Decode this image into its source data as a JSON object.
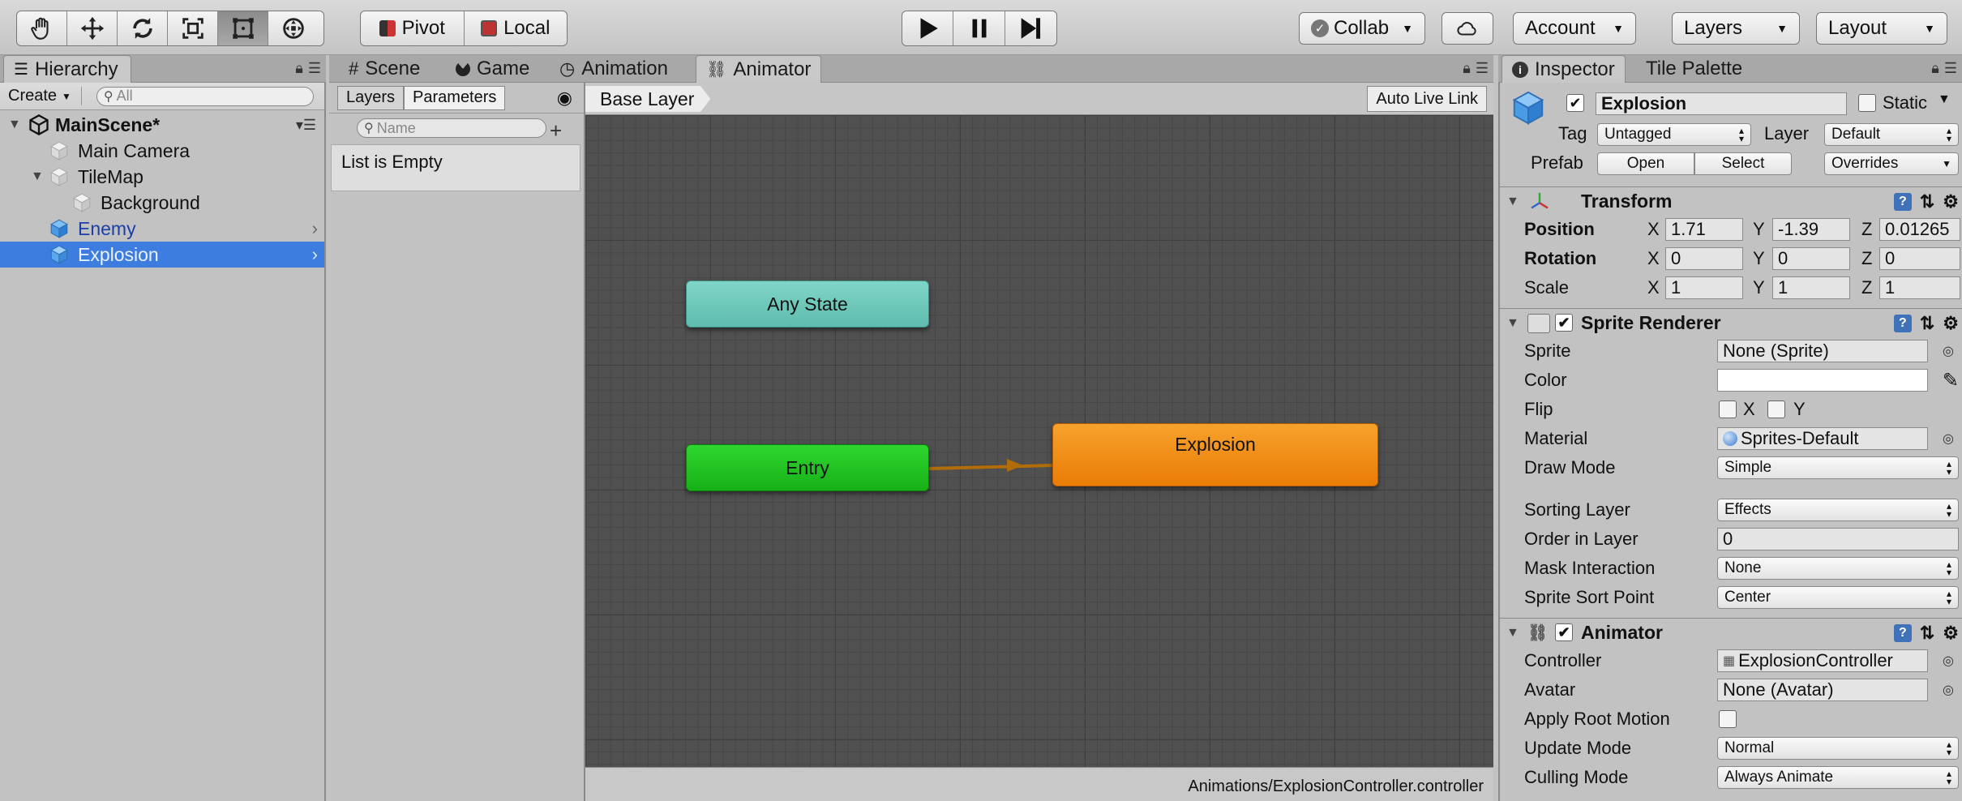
{
  "toolbar": {
    "pivot_label": "Pivot",
    "local_label": "Local",
    "collab_label": "Collab",
    "account_label": "Account",
    "layers_label": "Layers",
    "layout_label": "Layout"
  },
  "tabs": {
    "hierarchy": "Hierarchy",
    "scene": "Scene",
    "game": "Game",
    "animation": "Animation",
    "animator": "Animator",
    "inspector": "Inspector",
    "tile_palette": "Tile Palette"
  },
  "hierarchy": {
    "create_label": "Create",
    "search_placeholder": "All",
    "scene_name": "MainScene*",
    "items": [
      {
        "label": "Main Camera"
      },
      {
        "label": "TileMap"
      },
      {
        "label": "Background"
      },
      {
        "label": "Enemy"
      },
      {
        "label": "Explosion"
      }
    ]
  },
  "animator": {
    "tab_layers": "Layers",
    "tab_parameters": "Parameters",
    "param_search_placeholder": "Name",
    "empty_text": "List is Empty",
    "breadcrumb": "Base Layer",
    "auto_live_link": "Auto Live Link",
    "nodes": {
      "any_state": "Any State",
      "entry": "Entry",
      "explosion": "Explosion"
    },
    "status_path": "Animations/ExplosionController.controller"
  },
  "inspector": {
    "object_name": "Explosion",
    "static_label": "Static",
    "tag_label": "Tag",
    "tag_value": "Untagged",
    "layer_label": "Layer",
    "layer_value": "Default",
    "prefab_label": "Prefab",
    "open_label": "Open",
    "select_label": "Select",
    "overrides_label": "Overrides",
    "transform": {
      "title": "Transform",
      "position_label": "Position",
      "rotation_label": "Rotation",
      "scale_label": "Scale",
      "position": {
        "x": "1.71",
        "y": "-1.39",
        "z": "0.01265"
      },
      "rotation": {
        "x": "0",
        "y": "0",
        "z": "0"
      },
      "scale": {
        "x": "1",
        "y": "1",
        "z": "1"
      }
    },
    "sprite_renderer": {
      "title": "Sprite Renderer",
      "sprite_label": "Sprite",
      "sprite_value": "None (Sprite)",
      "color_label": "Color",
      "flip_label": "Flip",
      "flip_x": "X",
      "flip_y": "Y",
      "material_label": "Material",
      "material_value": "Sprites-Default",
      "draw_mode_label": "Draw Mode",
      "draw_mode_value": "Simple",
      "sorting_layer_label": "Sorting Layer",
      "sorting_layer_value": "Effects",
      "order_label": "Order in Layer",
      "order_value": "0",
      "mask_label": "Mask Interaction",
      "mask_value": "None",
      "sort_point_label": "Sprite Sort Point",
      "sort_point_value": "Center"
    },
    "animator_comp": {
      "title": "Animator",
      "controller_label": "Controller",
      "controller_value": "ExplosionController",
      "avatar_label": "Avatar",
      "avatar_value": "None (Avatar)",
      "root_motion_label": "Apply Root Motion",
      "update_mode_label": "Update Mode",
      "update_mode_value": "Normal",
      "culling_label": "Culling Mode",
      "culling_value": "Always Animate"
    }
  },
  "colors": {
    "any_state": "#6cc7b9",
    "entry": "#1fbf1f",
    "explosion": "#f08a10",
    "transition": "#b06d0a",
    "selection": "#3e7de0",
    "graph_bg": "#505050"
  }
}
